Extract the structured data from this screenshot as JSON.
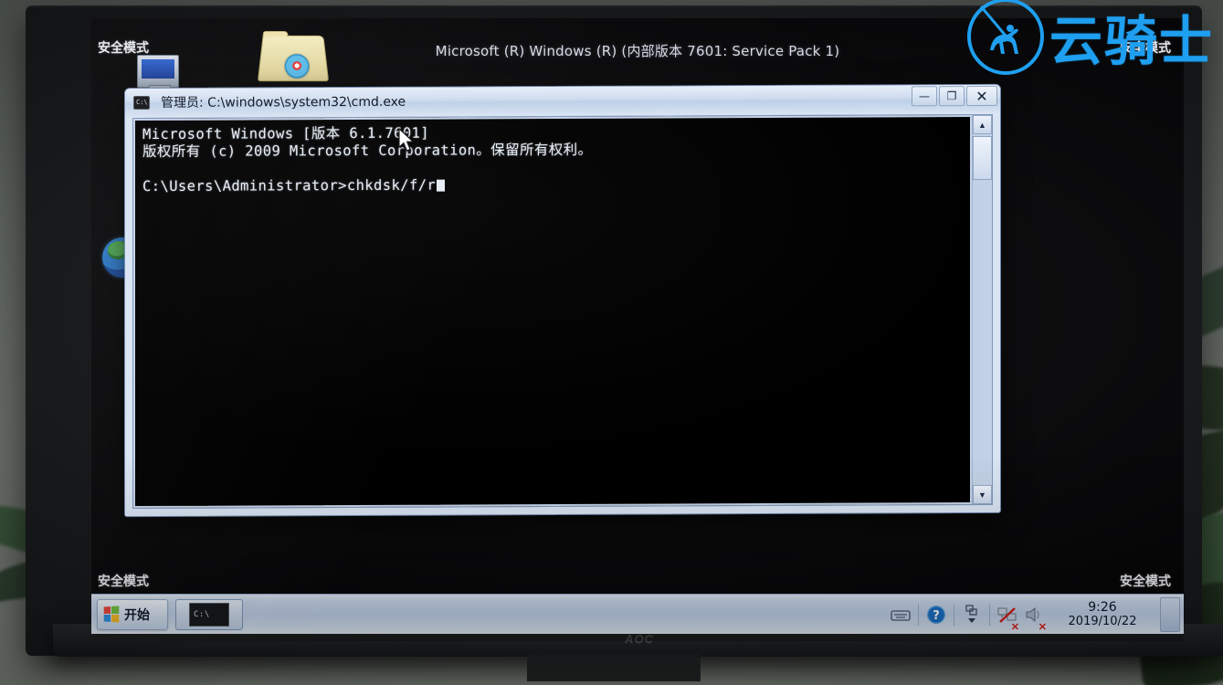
{
  "environment": {
    "monitor_brand": "AOC"
  },
  "desktop": {
    "safe_mode_label": "安全模式",
    "build_caption": "Microsoft (R) Windows (R) (内部版本 7601: Service Pack 1)",
    "icons": [
      {
        "name": "computer-icon",
        "label": ""
      },
      {
        "name": "folder-icon",
        "label": ""
      },
      {
        "name": "internet-explorer-icon",
        "label": ""
      }
    ]
  },
  "watermark": {
    "text": "云骑士",
    "logo_name": "horse-rider-circle-icon",
    "color": "#1f9ff0"
  },
  "cmd_window": {
    "title": "管理员: C:\\windows\\system32\\cmd.exe",
    "icon_label": "C:\\",
    "controls": {
      "minimize": "—",
      "maximize": "❐",
      "close": "✕"
    },
    "console_lines": [
      "Microsoft Windows [版本 6.1.7601]",
      "版权所有 (c) 2009 Microsoft Corporation。保留所有权利。",
      "",
      "C:\\Users\\Administrator>chkdsk/f/r"
    ],
    "prompt": "C:\\Users\\Administrator>",
    "command": "chkdsk/f/r",
    "scrollbar": {
      "up_arrow": "▲",
      "down_arrow": "▼"
    }
  },
  "taskbar": {
    "start_label": "开始",
    "task_items": [
      {
        "name": "taskbar-item-cmd",
        "label": "C:\\"
      }
    ],
    "tray": {
      "icons": [
        {
          "name": "keyboard-icon",
          "glyph": "⌨"
        },
        {
          "name": "help-icon",
          "glyph": "?"
        },
        {
          "name": "show-hidden-icons-icon",
          "glyph": "▲"
        },
        {
          "name": "network-disconnected-icon",
          "glyph": "🖧",
          "badge": "✕"
        },
        {
          "name": "volume-muted-icon",
          "glyph": "🔊",
          "badge": "✕"
        }
      ],
      "clock": {
        "time": "9:26",
        "date": "2019/10/22"
      },
      "show_desktop_label": ""
    }
  }
}
